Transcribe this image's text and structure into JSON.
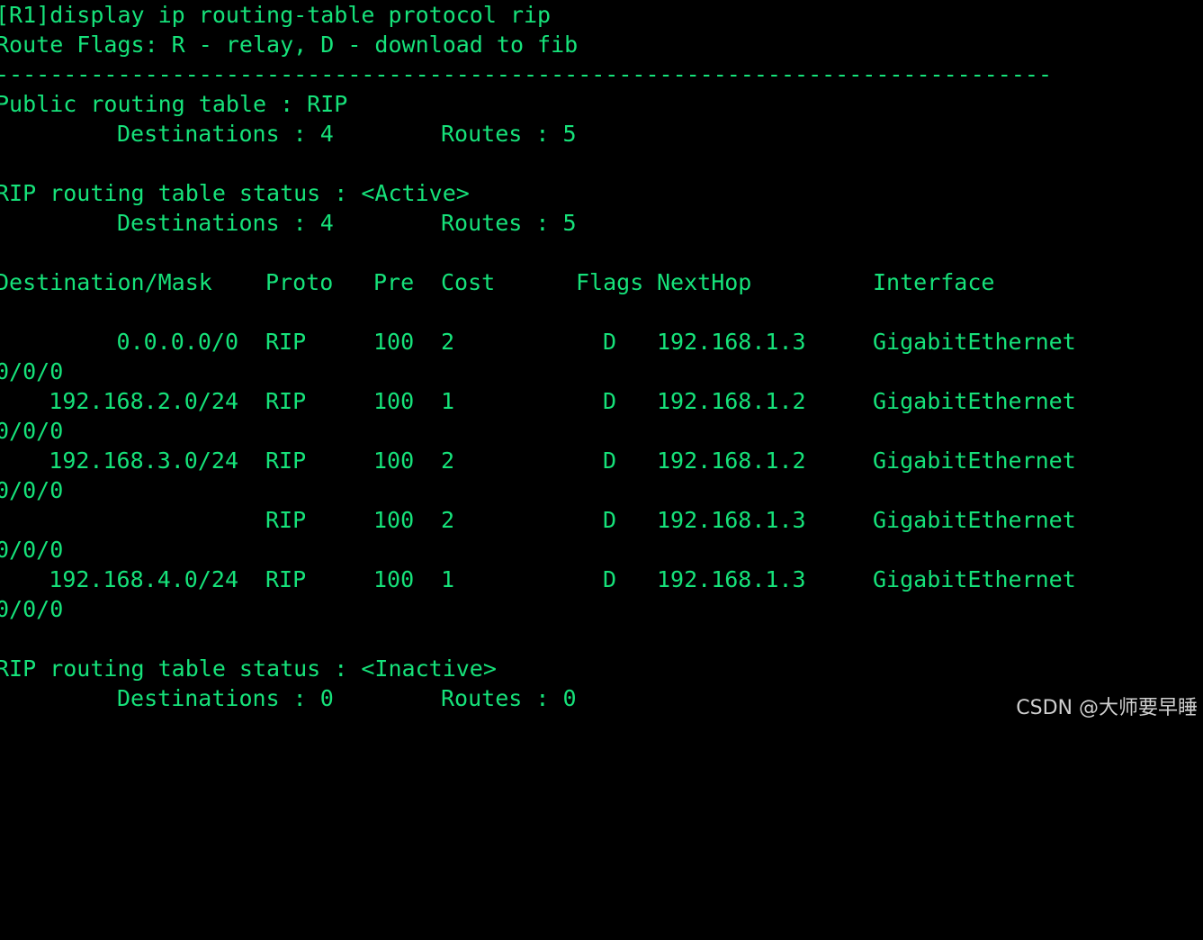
{
  "terminal": {
    "command": "[R1]display ip routing-table protocol rip",
    "route_flags": "Route Flags: R - relay, D - download to fib",
    "separator": "------------------------------------------------------------------------------",
    "public_table": {
      "title": "Public routing table : RIP",
      "destinations": "Destinations : 4",
      "routes": "Routes : 5"
    },
    "active_section": {
      "title": "RIP routing table status : <Active>",
      "destinations": "Destinations : 4",
      "routes": "Routes : 5"
    },
    "headers": {
      "destination": "Destination/Mask",
      "proto": "Proto",
      "pre": "Pre",
      "cost": "Cost",
      "flags": "Flags",
      "nexthop": "NextHop",
      "interface": "Interface"
    },
    "rows": [
      {
        "dest": "0.0.0.0/0",
        "proto": "RIP",
        "pre": "100",
        "cost": "2",
        "flags": "D",
        "nexthop": "192.168.1.3",
        "interface": "GigabitEthernet",
        "interface_cont": "0/0/0"
      },
      {
        "dest": "192.168.2.0/24",
        "proto": "RIP",
        "pre": "100",
        "cost": "1",
        "flags": "D",
        "nexthop": "192.168.1.2",
        "interface": "GigabitEthernet",
        "interface_cont": "0/0/0"
      },
      {
        "dest": "192.168.3.0/24",
        "proto": "RIP",
        "pre": "100",
        "cost": "2",
        "flags": "D",
        "nexthop": "192.168.1.2",
        "interface": "GigabitEthernet",
        "interface_cont": "0/0/0"
      },
      {
        "dest": "",
        "proto": "RIP",
        "pre": "100",
        "cost": "2",
        "flags": "D",
        "nexthop": "192.168.1.3",
        "interface": "GigabitEthernet",
        "interface_cont": "0/0/0"
      },
      {
        "dest": "192.168.4.0/24",
        "proto": "RIP",
        "pre": "100",
        "cost": "1",
        "flags": "D",
        "nexthop": "192.168.1.3",
        "interface": "GigabitEthernet",
        "interface_cont": "0/0/0"
      }
    ],
    "inactive_section": {
      "title": "RIP routing table status : <Inactive>",
      "destinations": "Destinations : 0",
      "routes": "Routes : 0"
    }
  },
  "watermark": "CSDN @大师要早睡",
  "colors": {
    "background": "#000000",
    "text": "#16e27a",
    "watermark": "#d0d0d0"
  }
}
